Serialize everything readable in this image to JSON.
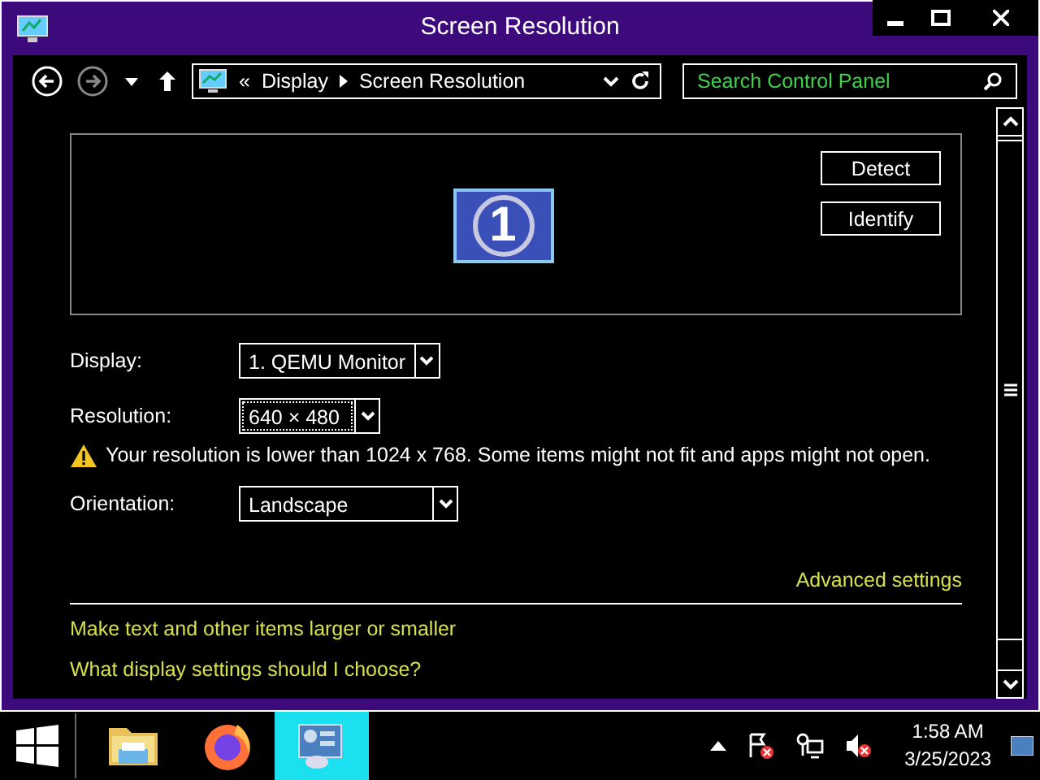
{
  "window": {
    "title": "Screen Resolution"
  },
  "address_bar": {
    "breadcrumb": [
      "Display",
      "Screen Resolution"
    ],
    "prefix": "«"
  },
  "search": {
    "placeholder": "Search Control Panel"
  },
  "monitor_preview": {
    "monitors": [
      "1"
    ],
    "buttons": [
      "Detect",
      "Identify"
    ]
  },
  "fields": [
    {
      "label": "Display:",
      "value": "1. QEMU Monitor",
      "focused": false
    },
    {
      "label": "Resolution:",
      "value": "640 × 480",
      "focused": true
    },
    {
      "kind": "warning",
      "text": "Your resolution is lower than 1024 x 768. Some items might not fit and apps might not open."
    },
    {
      "label": "Orientation:",
      "value": "Landscape",
      "focused": false
    }
  ],
  "advanced_link": "Advanced settings",
  "links": [
    "Make text and other items larger or smaller",
    "What display settings should I choose?"
  ],
  "taskbar": {
    "apps": [
      {
        "kind": "explorer",
        "selected": false
      },
      {
        "kind": "firefox",
        "selected": false
      },
      {
        "kind": "control-panel",
        "selected": true
      }
    ],
    "time": "1:58 AM",
    "date": "3/25/2023"
  }
}
